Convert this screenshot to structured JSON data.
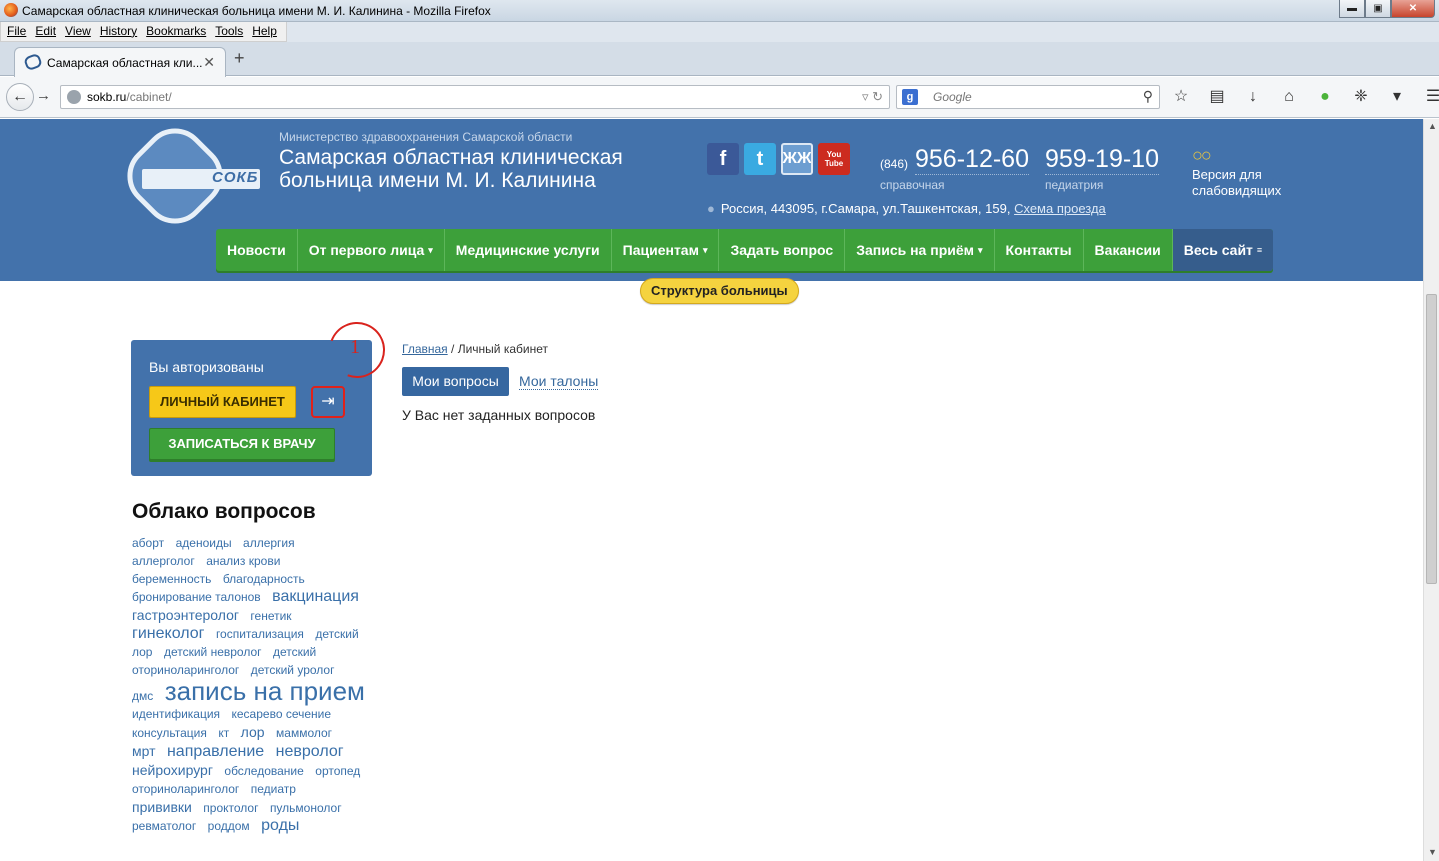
{
  "window": {
    "title": "Самарская областная клиническая больница имени М. И. Калинина - Mozilla Firefox",
    "controls": {
      "minimize": "▬",
      "maximize": "▣",
      "close": "✕"
    }
  },
  "menubar": [
    "File",
    "Edit",
    "View",
    "History",
    "Bookmarks",
    "Tools",
    "Help"
  ],
  "tab": {
    "label": "Самарская областная кли...",
    "close": "✕",
    "new_tab": "+"
  },
  "navbar": {
    "url_host": "sokb.ru",
    "url_path": "/cabinet/",
    "search_engine": "Google",
    "search_placeholder": "Google"
  },
  "header": {
    "ministry": "Министерство здравоохранения Самарской области",
    "hospital_name": "Самарская областная клиническая больница имени М. И. Калинина",
    "logo_text": "СОКБ",
    "social": [
      "f",
      "t",
      "ЖЖ",
      "You Tube"
    ],
    "phone_code": "(846)",
    "phone1": "956-12-60",
    "phone1_label": "справочная",
    "phone2": "959-19-10",
    "phone2_label": "педиатрия",
    "vision_label": "Версия для слабовидящих",
    "address": "Россия, 443095, г.Самара, ул.Ташкентская, 159,",
    "route_link": "Схема проезда"
  },
  "mainnav": [
    {
      "label": "Новости",
      "caret": ""
    },
    {
      "label": "От первого лица",
      "caret": "▾"
    },
    {
      "label": "Медицинские услуги",
      "caret": ""
    },
    {
      "label": "Пациентам",
      "caret": "▾"
    },
    {
      "label": "Задать вопрос",
      "caret": ""
    },
    {
      "label": "Запись на приём",
      "caret": "▾"
    },
    {
      "label": "Контакты",
      "caret": ""
    },
    {
      "label": "Вакансии",
      "caret": ""
    },
    {
      "label": "Весь сайт",
      "caret": "≡"
    }
  ],
  "structure_button": "Структура больницы",
  "auth": {
    "status": "Вы авторизованы",
    "cabinet_button": "ЛИЧНЫЙ КАБИНЕТ",
    "exit_icon": "⇥",
    "appointment_button": "ЗАПИСАТЬСЯ К ВРАЧУ",
    "annotation_number": "1"
  },
  "content": {
    "breadcrumb_home": "Главная",
    "breadcrumb_sep": " / ",
    "breadcrumb_current": "Личный кабинет",
    "tab_active": "Мои вопросы",
    "tab_other": "Мои талоны",
    "no_questions": "У Вас нет заданных вопросов"
  },
  "cloud": {
    "title": "Облако вопросов",
    "tags": [
      {
        "t": "аборт",
        "s": 1
      },
      {
        "t": "аденоиды",
        "s": 1
      },
      {
        "t": "аллергия",
        "s": 1
      },
      {
        "t": "аллерголог",
        "s": 1
      },
      {
        "t": "анализ крови",
        "s": 1
      },
      {
        "t": "беременность",
        "s": 1
      },
      {
        "t": "благодарность",
        "s": 1
      },
      {
        "t": "бронирование талонов",
        "s": 1
      },
      {
        "t": "вакцинация",
        "s": 3
      },
      {
        "t": "гастроэнтеролог",
        "s": 2
      },
      {
        "t": "генетик",
        "s": 1
      },
      {
        "t": "гинеколог",
        "s": 3
      },
      {
        "t": "госпитализация",
        "s": 1
      },
      {
        "t": "детский",
        "s": 1
      },
      {
        "t": "лор",
        "s": 1
      },
      {
        "t": "детский невролог",
        "s": 1
      },
      {
        "t": "детский",
        "s": 1
      },
      {
        "t": "оториноларинголог",
        "s": 1
      },
      {
        "t": "детский уролог",
        "s": 1
      },
      {
        "t": "дмс",
        "s": 1
      },
      {
        "t": "запись на прием",
        "s": 4
      },
      {
        "t": "идентификация",
        "s": 1
      },
      {
        "t": "кесарево сечение",
        "s": 1
      },
      {
        "t": "консультация",
        "s": 1
      },
      {
        "t": "кт",
        "s": 1
      },
      {
        "t": "лор",
        "s": 2
      },
      {
        "t": "маммолог",
        "s": 1
      },
      {
        "t": "мрт",
        "s": 2
      },
      {
        "t": "направление",
        "s": 3
      },
      {
        "t": "невролог",
        "s": 3
      },
      {
        "t": "нейрохирург",
        "s": 2
      },
      {
        "t": "обследование",
        "s": 1
      },
      {
        "t": "ортопед",
        "s": 1
      },
      {
        "t": "оториноларинголог",
        "s": 1
      },
      {
        "t": "педиатр",
        "s": 1
      },
      {
        "t": "прививки",
        "s": 2
      },
      {
        "t": "проктолог",
        "s": 1
      },
      {
        "t": "пульмонолог",
        "s": 1
      },
      {
        "t": "ревматолог",
        "s": 1
      },
      {
        "t": "роддом",
        "s": 1
      },
      {
        "t": "роды",
        "s": 3
      }
    ]
  }
}
